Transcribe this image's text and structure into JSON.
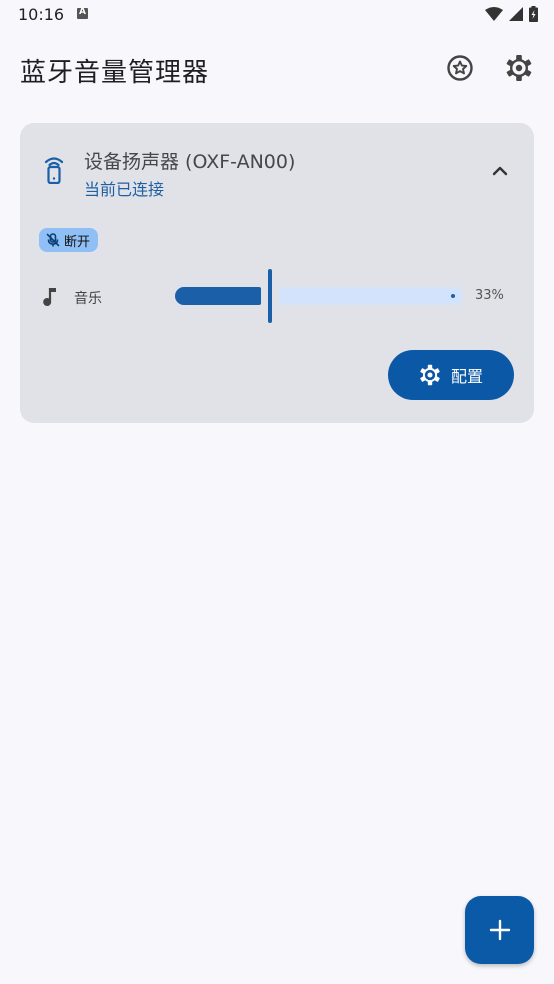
{
  "status_bar": {
    "time": "10:16",
    "icons": [
      "a-notification-icon",
      "wifi-icon",
      "signal-icon",
      "battery-charging-icon"
    ]
  },
  "app_bar": {
    "title": "蓝牙音量管理器",
    "actions": [
      "star-icon",
      "gear-icon"
    ]
  },
  "device": {
    "name": "设备扬声器 (OXF-AN00)",
    "status": "当前已连接",
    "icon": "phone-speaker-icon",
    "expanded": true,
    "chip": {
      "label": "断开",
      "icon": "mic-off-icon"
    },
    "volume": {
      "label": "音乐",
      "icon": "music-note-icon",
      "percent_text": "33%",
      "value": 0.33
    },
    "config_button": {
      "label": "配置",
      "icon": "gear-icon"
    }
  },
  "fab": {
    "icon": "plus-icon"
  },
  "colors": {
    "primary": "#0b59a6",
    "card_bg": "#e0e2e8",
    "chip_bg": "#8fbff5",
    "track_inactive": "#d2e3fb",
    "page_bg": "#f8f8fc"
  }
}
